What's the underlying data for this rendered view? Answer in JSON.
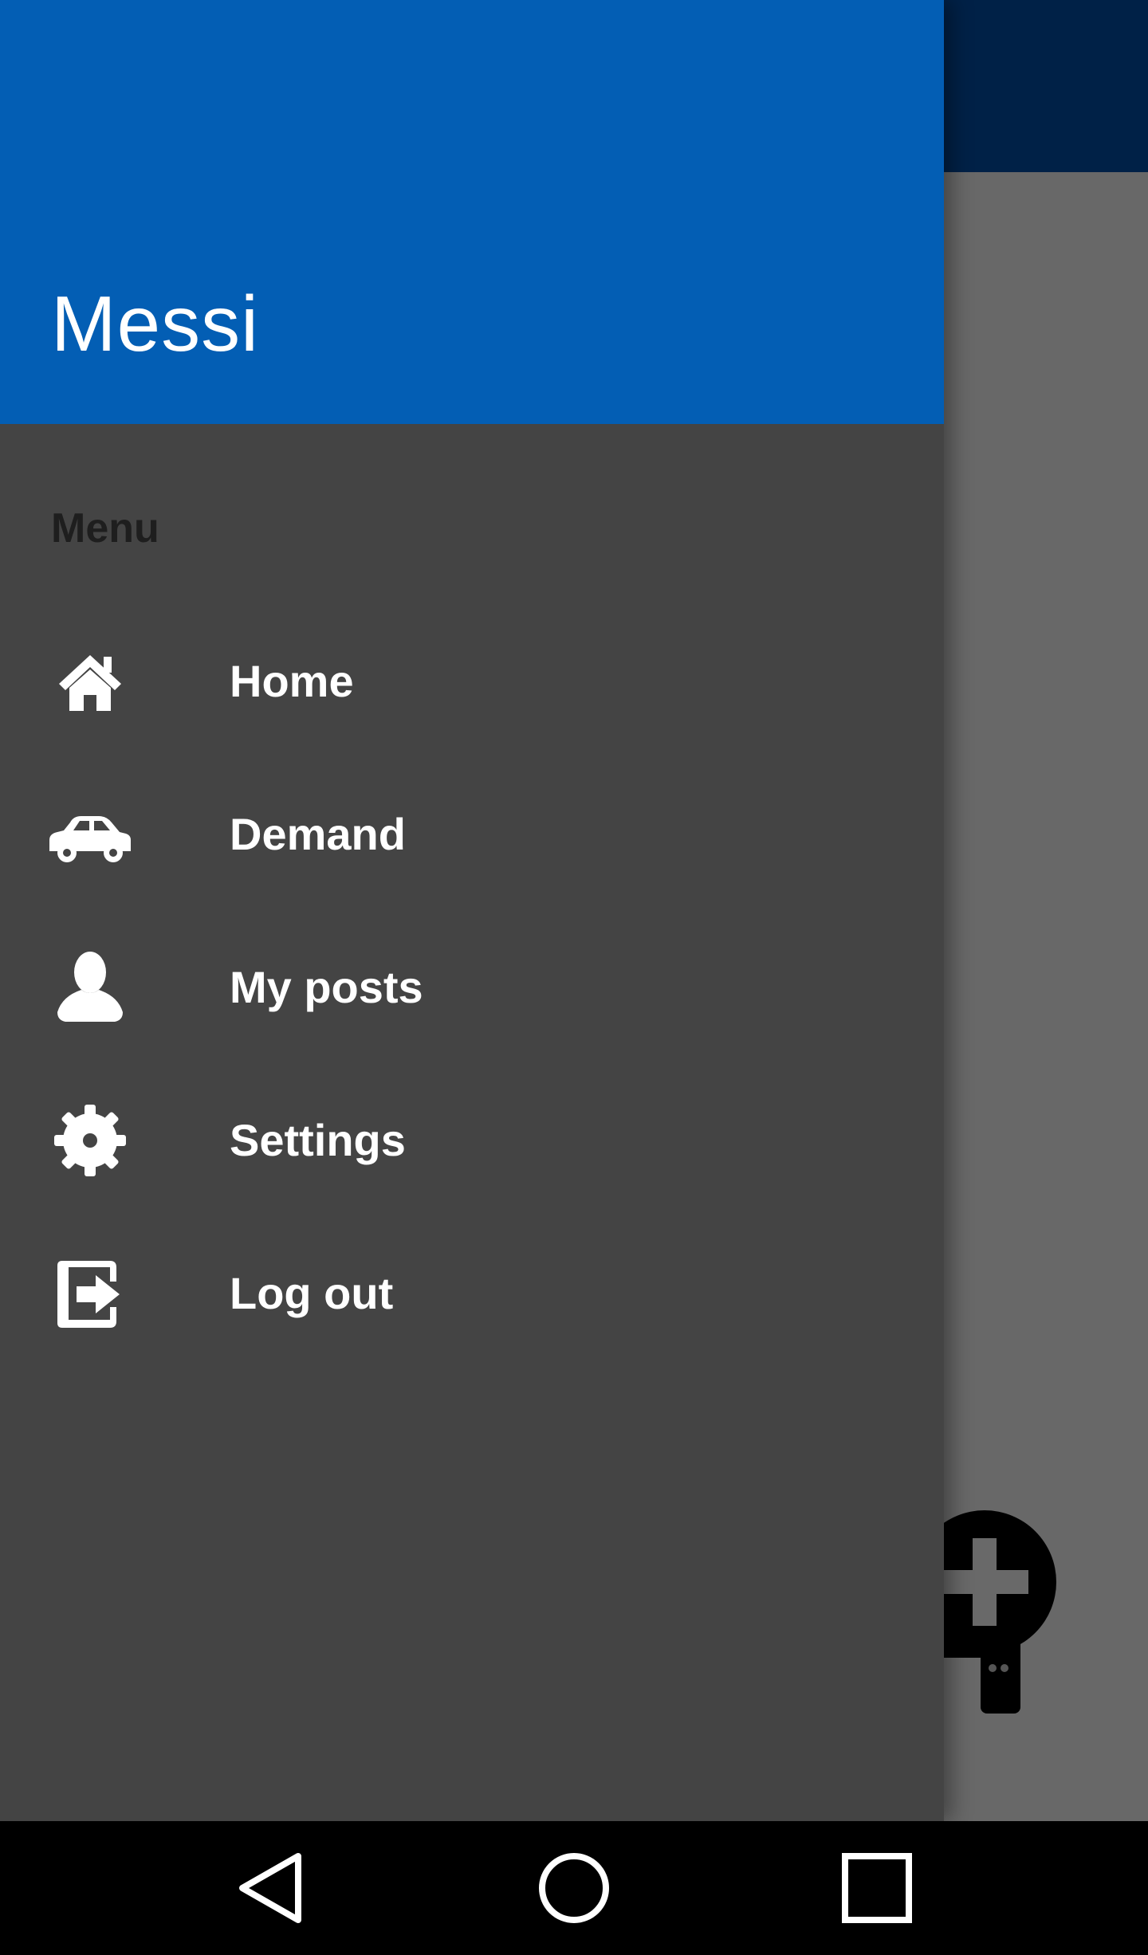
{
  "drawer": {
    "user_name": "Messi",
    "menu_heading": "Menu",
    "items": [
      {
        "label": "Home",
        "icon": "home-icon"
      },
      {
        "label": "Demand",
        "icon": "car-icon"
      },
      {
        "label": "My posts",
        "icon": "person-icon"
      },
      {
        "label": "Settings",
        "icon": "gear-icon"
      },
      {
        "label": "Log out",
        "icon": "logout-icon"
      }
    ]
  },
  "background": {
    "fab_icon": "add-icon"
  },
  "system_nav": {
    "back_icon": "back-triangle-icon",
    "home_icon": "home-circle-icon",
    "recents_icon": "recents-square-icon"
  },
  "colors": {
    "drawer_header": "#035eb4",
    "drawer_body": "#444444",
    "app_bar": "#002147",
    "scrim_content": "#686868",
    "nav_bar": "#000000"
  }
}
